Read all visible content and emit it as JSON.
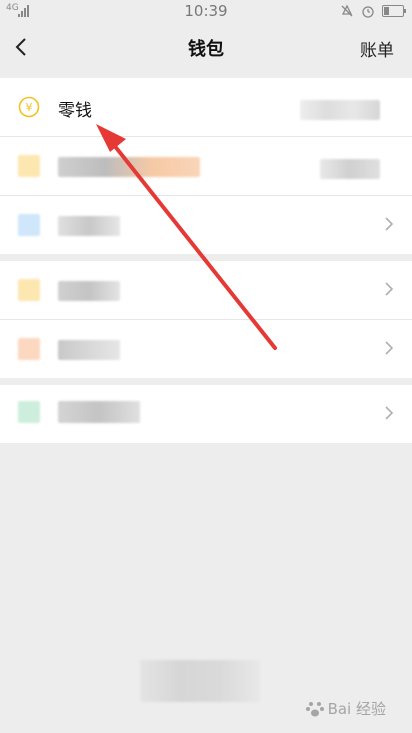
{
  "status_bar": {
    "network": "4G",
    "time": "10:39"
  },
  "header": {
    "title": "钱包",
    "right_action": "账单"
  },
  "wallet": {
    "change_label": "零钱",
    "change_icon": "yen-coin-icon"
  },
  "watermark": {
    "text": "Bai 经验"
  },
  "colors": {
    "background": "#ededed",
    "accent_yellow": "#f2c21f",
    "arrow_red": "#e53935"
  }
}
